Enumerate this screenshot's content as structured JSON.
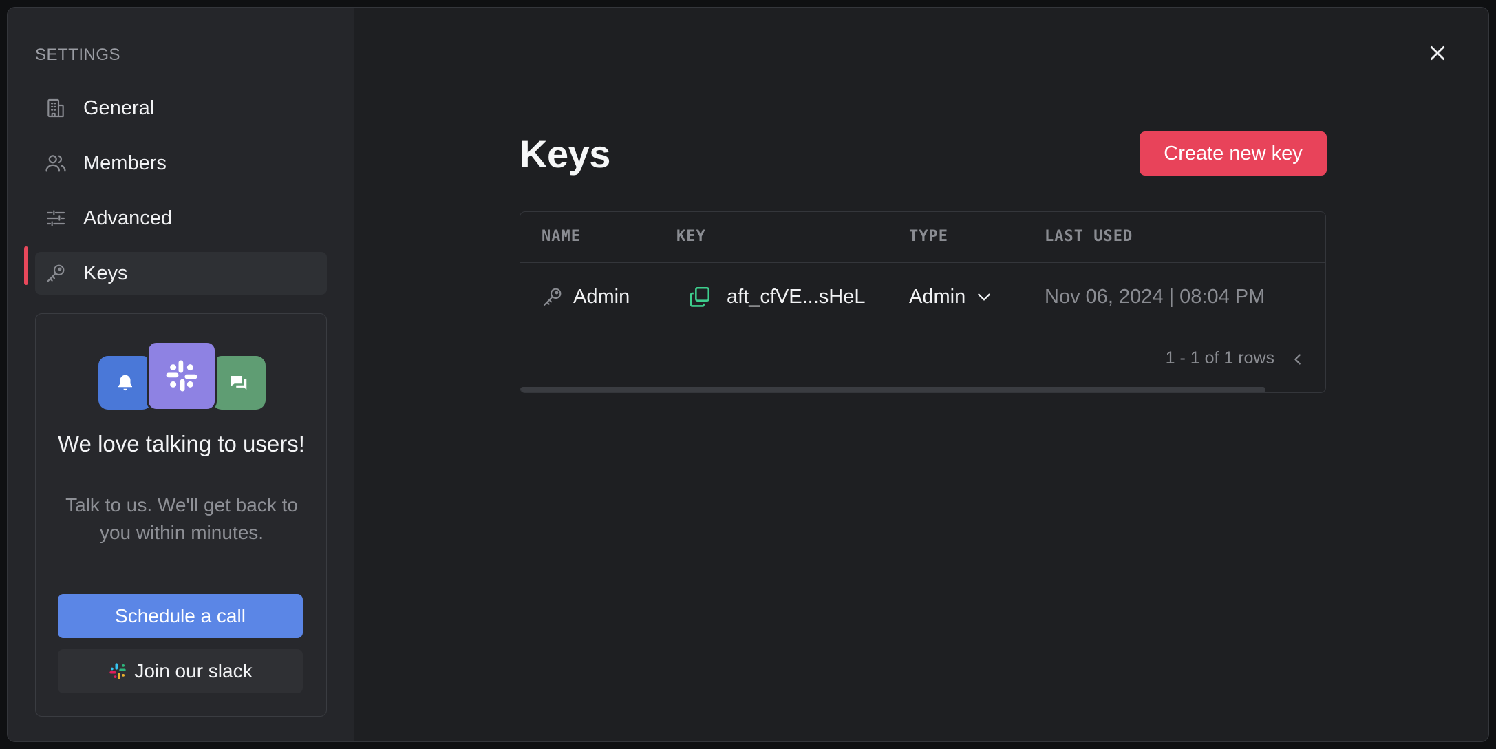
{
  "sidebar": {
    "heading": "SETTINGS",
    "items": [
      {
        "label": "General",
        "icon": "building-icon"
      },
      {
        "label": "Members",
        "icon": "users-icon"
      },
      {
        "label": "Advanced",
        "icon": "sliders-icon"
      },
      {
        "label": "Keys",
        "icon": "key-icon",
        "active": true
      }
    ]
  },
  "promo": {
    "title": "We love talking to users!",
    "text": "Talk to us. We'll get back to you within minutes.",
    "schedule_label": "Schedule a call",
    "slack_label": "Join our slack"
  },
  "main": {
    "title": "Keys",
    "create_label": "Create new key",
    "table": {
      "columns": [
        "NAME",
        "KEY",
        "TYPE",
        "LAST USED"
      ],
      "rows": [
        {
          "name": "Admin",
          "key": "aft_cfVE...sHeL",
          "type": "Admin",
          "last_used": "Nov 06, 2024 | 08:04 PM"
        }
      ],
      "pagination": "1 - 1 of 1 rows"
    }
  },
  "colors": {
    "accent": "#e8435a",
    "primary_button": "#5b86e6",
    "background": "#1e1f22",
    "sidebar": "#25262a"
  }
}
